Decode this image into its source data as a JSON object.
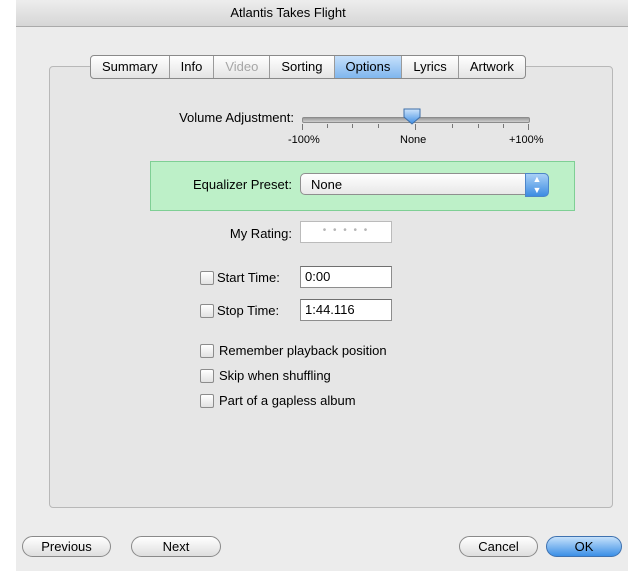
{
  "window": {
    "title": "Atlantis Takes Flight"
  },
  "tabs": [
    {
      "label": "Summary"
    },
    {
      "label": "Info"
    },
    {
      "label": "Video"
    },
    {
      "label": "Sorting"
    },
    {
      "label": "Options"
    },
    {
      "label": "Lyrics"
    },
    {
      "label": "Artwork"
    }
  ],
  "active_tab": "Options",
  "volume": {
    "label": "Volume Adjustment:",
    "min_label": "-100%",
    "mid_label": "None",
    "max_label": "+100%",
    "value_percent": 0
  },
  "equalizer": {
    "label": "Equalizer Preset:",
    "value": "None",
    "highlight_color": "#bdf0c8"
  },
  "rating": {
    "label": "My Rating:",
    "stars": 0
  },
  "start_time": {
    "label": "Start Time:",
    "value": "0:00",
    "checked": false
  },
  "stop_time": {
    "label": "Stop Time:",
    "value": "1:44.116",
    "checked": false
  },
  "options": [
    {
      "label": "Remember playback position",
      "checked": false
    },
    {
      "label": "Skip when shuffling",
      "checked": false
    },
    {
      "label": "Part of a gapless album",
      "checked": false
    }
  ],
  "buttons": {
    "previous": "Previous",
    "next": "Next",
    "cancel": "Cancel",
    "ok": "OK"
  },
  "colors": {
    "selection_blue": "#7fb6ee",
    "default_button": "#3b8fe6"
  }
}
